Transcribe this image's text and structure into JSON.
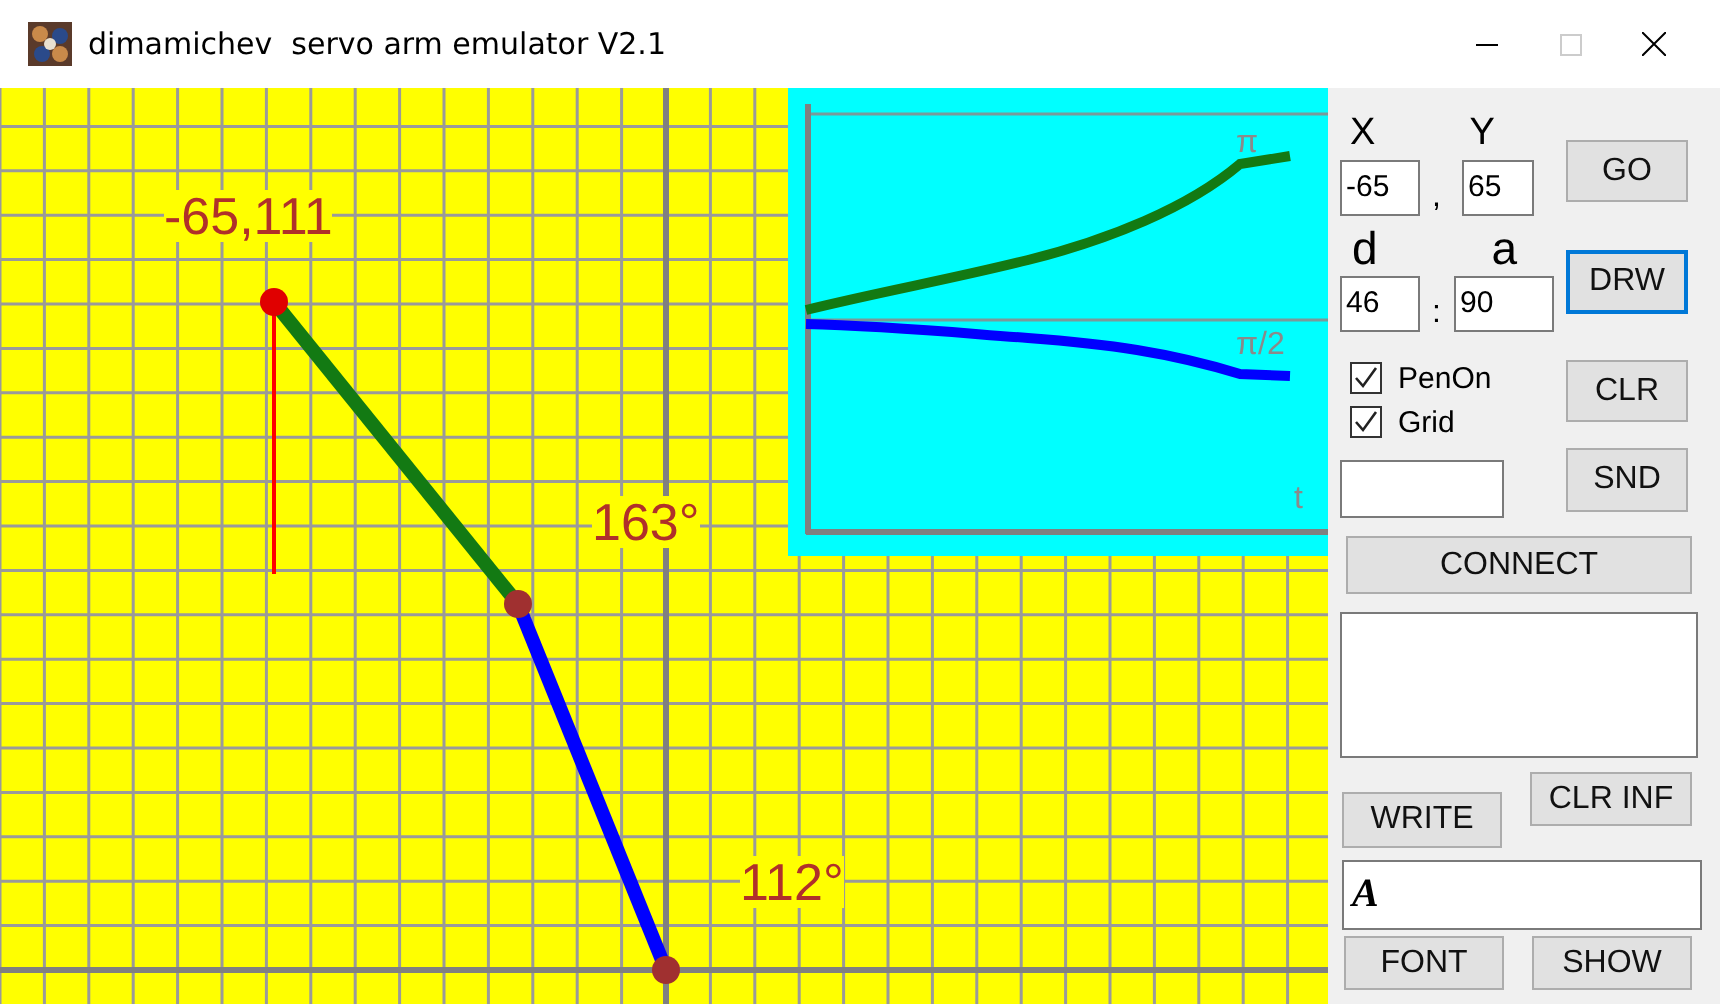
{
  "window": {
    "title": "dimamichev  servo arm emulator V2.1",
    "maximize_disabled": true
  },
  "canvas": {
    "point_label": "-65,111",
    "elbow_angle": "163°",
    "base_angle": "112°"
  },
  "graph": {
    "top_label": "π",
    "mid_label": "π/2",
    "axis_label": "t"
  },
  "coords": {
    "x_label": "X",
    "x_value": "-65",
    "separator": ",",
    "y_label": "Y",
    "y_value": "65"
  },
  "polar": {
    "d_label": "d",
    "d_value": "46",
    "separator": ":",
    "a_label": "a",
    "a_value": "90"
  },
  "checkboxes": [
    {
      "label": "PenOn",
      "checked": true
    },
    {
      "label": "Grid",
      "checked": true
    }
  ],
  "buttons": {
    "go": {
      "label": "GO",
      "focused": false
    },
    "drw": {
      "label": "DRW",
      "focused": true
    },
    "clr": {
      "label": "CLR",
      "focused": false
    },
    "snd": {
      "label": "SND",
      "focused": false
    },
    "connect": {
      "label": "CONNECT",
      "focused": false
    },
    "write": {
      "label": "WRITE",
      "focused": false
    },
    "clr_inf": {
      "label": "CLR INF",
      "focused": false
    },
    "font": {
      "label": "FONT",
      "focused": false
    },
    "show": {
      "label": "SHOW",
      "focused": false
    }
  },
  "font_field": {
    "sample": "A"
  }
}
